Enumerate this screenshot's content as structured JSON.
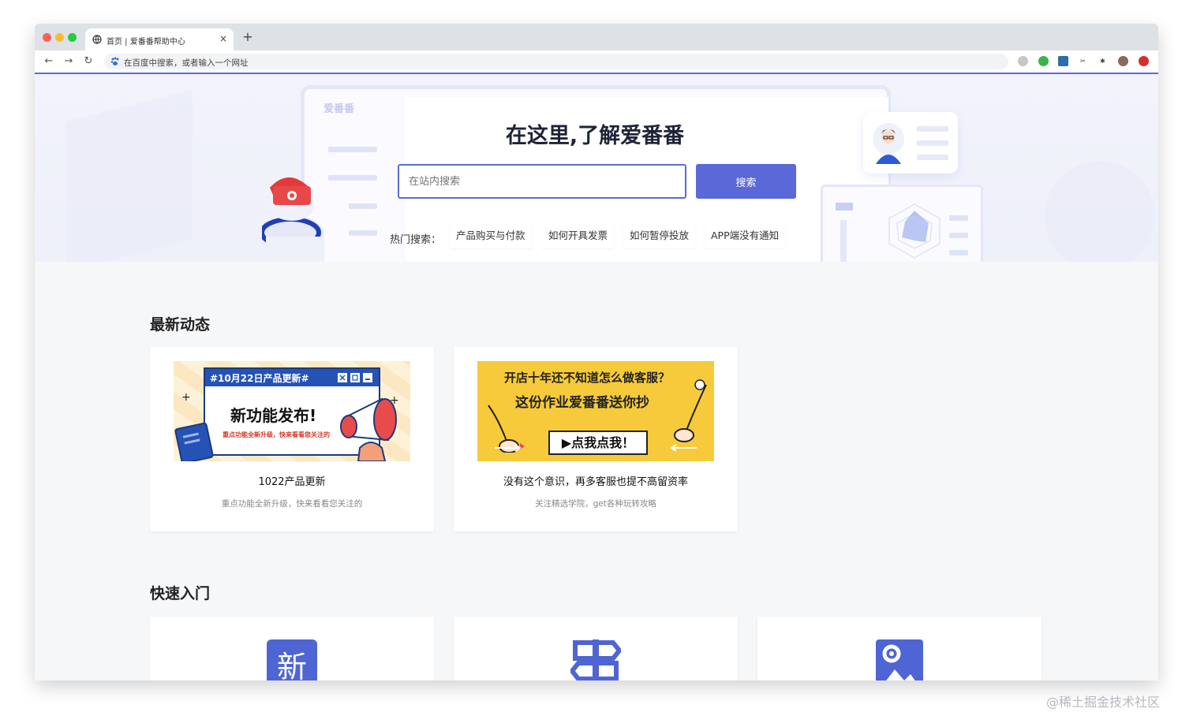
{
  "browser": {
    "tab_title": "首页 | 爱番番帮助中心",
    "tab_close": "×",
    "new_tab": "+",
    "nav_back": "←",
    "nav_forward": "→",
    "nav_reload": "↻",
    "omnibox_placeholder": "在百度中搜索，或者输入一个网址"
  },
  "hero": {
    "logo_text": "爱番番",
    "title": "在这里,了解爱番番",
    "search_placeholder": "在站内搜索",
    "search_button": "搜索",
    "hot_label": "热门搜索：",
    "hot_tags": [
      "产品购买与付款",
      "如何开具发票",
      "如何暂停投放",
      "APP端没有通知"
    ]
  },
  "news": {
    "section_title": "最新动态",
    "cards": [
      {
        "banner_bar": "#10月22日产品更新#",
        "banner_main": "新功能发布!",
        "banner_sub": "重点功能全新升级，快来看看您关注的",
        "title": "1022产品更新",
        "subtitle": "重点功能全新升级，快来看看您关注的"
      },
      {
        "banner_line1": "开店十年还不知道怎么做客服？",
        "banner_line2": "这份作业爱番番送你抄",
        "banner_button": "▶点我点我！",
        "title": "没有这个意识，再多客服也提不高留资率",
        "subtitle": "关注精选学院，get各种玩转攻略"
      }
    ]
  },
  "quick": {
    "section_title": "快速入门",
    "icon1_char": "新"
  },
  "watermark": "@稀土掘金技术社区",
  "colors": {
    "accent": "#5b68d8",
    "hero_bg": "#f2f3fb",
    "page_bg": "#f6f7f9"
  }
}
